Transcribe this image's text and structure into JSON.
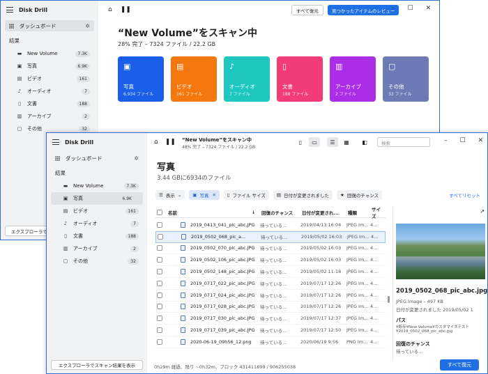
{
  "app": {
    "title": "Disk Drill"
  },
  "back": {
    "sidebar": {
      "dashboard": "ダッシュボード",
      "results_label": "結果",
      "items": [
        {
          "label": "New Volume",
          "count": "7.3K",
          "icon": "drive-icon"
        },
        {
          "label": "写真",
          "count": "6.9K",
          "icon": "photo-icon"
        },
        {
          "label": "ビデオ",
          "count": "161",
          "icon": "video-icon"
        },
        {
          "label": "オーディオ",
          "count": "7",
          "icon": "audio-icon"
        },
        {
          "label": "文書",
          "count": "188",
          "icon": "document-icon"
        },
        {
          "label": "アーカイブ",
          "count": "2",
          "icon": "archive-icon"
        },
        {
          "label": "その他",
          "count": "32",
          "icon": "other-icon"
        }
      ],
      "bottom_button": "エクスプローラでス"
    },
    "toolbar": {
      "recover_all": "すべて復元",
      "review_found": "見つかったアイテムのレビュー"
    },
    "scan": {
      "title": "“New Volume”をスキャン中",
      "subtitle": "28% 完了 – 7324 ファイル / 22.2 GB"
    },
    "cards": [
      {
        "name": "写真",
        "count": "6,934 ファイル",
        "color": "#1a5fe8",
        "icon": "photo-icon"
      },
      {
        "name": "ビデオ",
        "count": "161 ファイル",
        "color": "#f5780f",
        "icon": "video-icon"
      },
      {
        "name": "オーディオ",
        "count": "7 ファイル",
        "color": "#1fc7c1",
        "icon": "audio-icon"
      },
      {
        "name": "文書",
        "count": "188 ファイル",
        "color": "#f23c79",
        "icon": "document-icon"
      },
      {
        "name": "アーカイブ",
        "count": "2 ファイル",
        "color": "#ab2ee6",
        "icon": "archive-icon"
      },
      {
        "name": "その他",
        "count": "32 ファイル",
        "color": "#6d7ab5",
        "icon": "other-icon"
      }
    ]
  },
  "front": {
    "sidebar": {
      "dashboard": "ダッシュボード",
      "results_label": "結果",
      "items": [
        {
          "label": "New Volume",
          "count": "7.3K",
          "icon": "drive-icon"
        },
        {
          "label": "写真",
          "count": "6.9K",
          "icon": "photo-icon"
        },
        {
          "label": "ビデオ",
          "count": "161",
          "icon": "video-icon"
        },
        {
          "label": "オーディオ",
          "count": "7",
          "icon": "audio-icon"
        },
        {
          "label": "文書",
          "count": "188",
          "icon": "document-icon"
        },
        {
          "label": "アーカイブ",
          "count": "2",
          "icon": "archive-icon"
        },
        {
          "label": "その他",
          "count": "32",
          "icon": "other-icon"
        }
      ],
      "bottom_button": "エクスプローラでスキャン結果を表示"
    },
    "header": {
      "volume": "“New Volume”をスキャン中",
      "progress": "48% 完了 – 7324 ファイル / 22.2 GB",
      "search_placeholder": "検索"
    },
    "title": "写真",
    "subtitle": "3.44 GBに6934のファイル",
    "filters": {
      "view": "表示",
      "photo": "写真",
      "file_size": "ファイル サイズ",
      "date_changed": "日付が変更されました",
      "recovery_chance": "回復のチャンス",
      "reset_all": "すべてリセット"
    },
    "table": {
      "headers": {
        "name": "名前",
        "recovery": "回復のチャンス",
        "date": "日付が変更され...",
        "type": "種類",
        "size": "サイズ"
      },
      "rows": [
        {
          "name": "2019_0413_041_pic_abc.JPG",
          "recovery": "待っている...",
          "date": "2019/04/13 16:04",
          "type": "JPEG Im...",
          "size": "4..."
        },
        {
          "name": "2019_0502_068_pic_a...",
          "recovery": "待っている...",
          "date": "2019/05/02 16:03",
          "type": "JPEG Im...",
          "size": "4..."
        },
        {
          "name": "2019_0502_070_pic_abc.JPG",
          "recovery": "待っている...",
          "date": "2019/05/02 16:03",
          "type": "JPEG Im...",
          "size": "4..."
        },
        {
          "name": "2019_0502_106_pic_abc.JPG",
          "recovery": "待っている...",
          "date": "2019/05/02 16:03",
          "type": "JPEG Im...",
          "size": "4..."
        },
        {
          "name": "2019_0502_148_pic_abc.JPG",
          "recovery": "待っている...",
          "date": "2019/05/02 11:18",
          "type": "JPEG Im...",
          "size": "4..."
        },
        {
          "name": "2019_0717_022_pic_abc.JPG",
          "recovery": "待っている...",
          "date": "2019/07/17 12:26",
          "type": "JPEG Im...",
          "size": "4..."
        },
        {
          "name": "2019_0717_024_pic_abc.JPG",
          "recovery": "待っている...",
          "date": "2019/07/17 12:26",
          "type": "JPEG Im...",
          "size": "4..."
        },
        {
          "name": "2019_0717_028_pic_abc.JPG",
          "recovery": "待っている...",
          "date": "2019/07/17 12:26",
          "type": "JPEG Im...",
          "size": "4..."
        },
        {
          "name": "2019_0717_030_pic_abc.JPG",
          "recovery": "待っている...",
          "date": "2019/07/17 12:37",
          "type": "JPEG Im...",
          "size": "4..."
        },
        {
          "name": "2019_0717_039_pic_abc.JPG",
          "recovery": "待っている...",
          "date": "2019/07/17 12:50",
          "type": "JPEG Im...",
          "size": "4..."
        },
        {
          "name": "2020-06-19_09h56_12.png",
          "recovery": "待っている...",
          "date": "2020/06/19 9:56",
          "type": "PNG Im...",
          "size": "4..."
        }
      ]
    },
    "preview": {
      "filename": "2019_0502_068_pic_abc.jpg",
      "meta": "JPEG Image – 497 KB",
      "date": "日付が変更されました 2019/05/02 1",
      "path_label": "パス",
      "path_line1": "¥既存¥New Volume¥カスタマイズテスト",
      "path_line2": "¥2019_0502_068_pic_abc.jpg",
      "recovery_label": "回復のチャンス",
      "recovery_value": "待っている..."
    },
    "status": "0h29m 経過、残り ~0h32m、ブロック 431411899 / 906255038",
    "recover_all": "すべて復元"
  }
}
